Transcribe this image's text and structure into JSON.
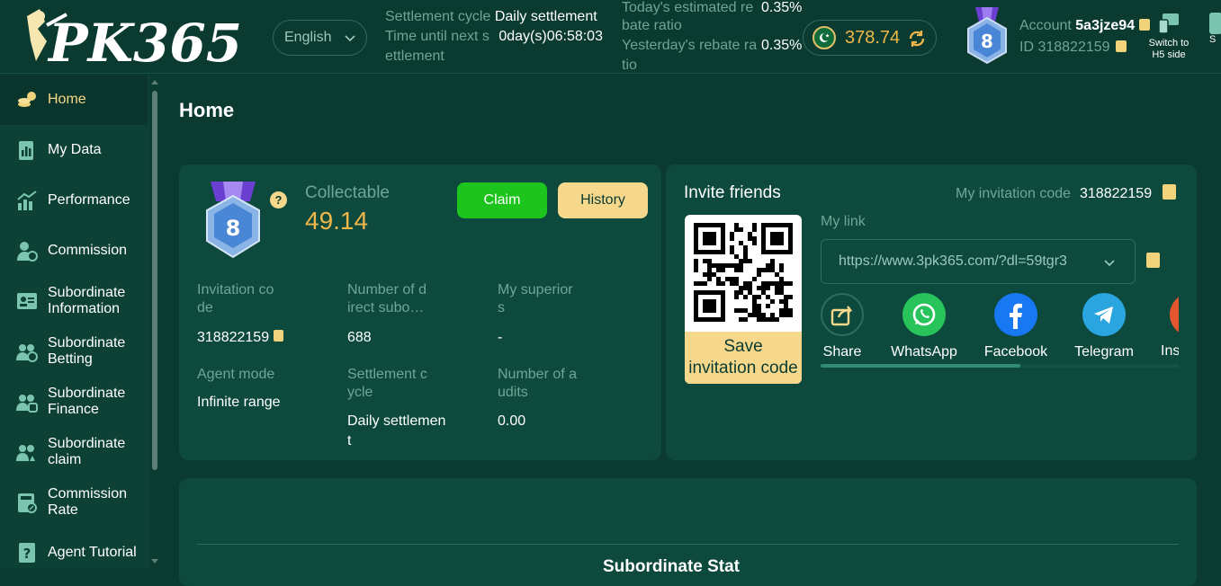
{
  "brand": {
    "logo_text": "PK365"
  },
  "header": {
    "language": "English",
    "settlement_cycle_label": "Settlement cycle",
    "settlement_cycle_value": "Daily settlement",
    "time_next_label_1": "Time until next s",
    "time_next_label_2": "ettlement",
    "time_next_value": "0day(s)06:58:03",
    "today_rebate_label_1": "Today's estimated re",
    "today_rebate_label_2": "bate ratio",
    "today_rebate_value": "0.35%",
    "yesterday_rebate_label_1": "Yesterday's rebate ra",
    "yesterday_rebate_label_2": "tio",
    "yesterday_rebate_value": "0.35%",
    "balance": "378.74",
    "account_label": "Account",
    "account_value": "5a3jze94",
    "id_label": "ID",
    "id_value": "318822159",
    "level": "8",
    "switch_label_1": "Switch to",
    "switch_label_2": "H5 side",
    "cut_label": "S"
  },
  "sidebar": {
    "items": [
      {
        "label": "Home",
        "icon": "coins-icon"
      },
      {
        "label": "My Data",
        "icon": "data-icon"
      },
      {
        "label": "Performance",
        "icon": "performance-chart-icon"
      },
      {
        "label": "Commission",
        "icon": "commission-user-icon"
      },
      {
        "label_1": "Subordinate",
        "label_2": "Information",
        "icon": "id-card-icon"
      },
      {
        "label_1": "Subordinate",
        "label_2": "Betting",
        "icon": "betting-users-icon"
      },
      {
        "label_1": "Subordinate",
        "label_2": "Finance",
        "icon": "finance-users-icon"
      },
      {
        "label_1": "Subordinate",
        "label_2": "claim",
        "icon": "claim-users-icon"
      },
      {
        "label_1": "Commission",
        "label_2": "Rate",
        "icon": "rate-calculator-icon"
      },
      {
        "label": "Agent Tutorial",
        "icon": "tutorial-book-icon"
      }
    ]
  },
  "main": {
    "title": "Home",
    "summary": {
      "level": "8",
      "collectable_label": "Collectable",
      "collectable_value": "49.14",
      "claim_button": "Claim",
      "history_button": "History",
      "help_glyph": "?",
      "invitation_code_label_1": "Invitation co",
      "invitation_code_label_2": "de",
      "invitation_code_value": "318822159",
      "direct_sub_label_1": "Number of d",
      "direct_sub_label_2": "irect subo…",
      "direct_sub_value": "688",
      "superiors_label_1": "My superior",
      "superiors_label_2": "s",
      "superiors_value": "-",
      "agent_mode_label": "Agent mode",
      "agent_mode_value": "Infinite range",
      "settlement_cycle_label_1": "Settlement c",
      "settlement_cycle_label_2": "ycle",
      "settlement_cycle_value_1": "Daily settlemen",
      "settlement_cycle_value_2": "t",
      "audits_label_1": "Number of a",
      "audits_label_2": "udits",
      "audits_value": "0.00"
    },
    "invite": {
      "title": "Invite friends",
      "my_code_label": "My invitation code",
      "my_code_value": "318822159",
      "my_link_label": "My link",
      "link_value": "https://www.3pk365.com/?dl=59tgr3",
      "save_code_1": "Save",
      "save_code_2": "invitation code",
      "share_targets": [
        {
          "label": "Share",
          "icon": "share-icon"
        },
        {
          "label": "WhatsApp",
          "icon": "whatsapp-icon"
        },
        {
          "label": "Facebook",
          "icon": "facebook-icon"
        },
        {
          "label": "Telegram",
          "icon": "telegram-icon"
        },
        {
          "label": "Ins",
          "icon": "instagram-icon"
        }
      ]
    },
    "stats_title": "Subordinate Stat"
  },
  "colors": {
    "accent_gold": "#f0b64a",
    "claim_green": "#1ec41e",
    "history_gold": "#f6d88c",
    "bg": "#0b3a31",
    "card": "#0d4a3d"
  }
}
